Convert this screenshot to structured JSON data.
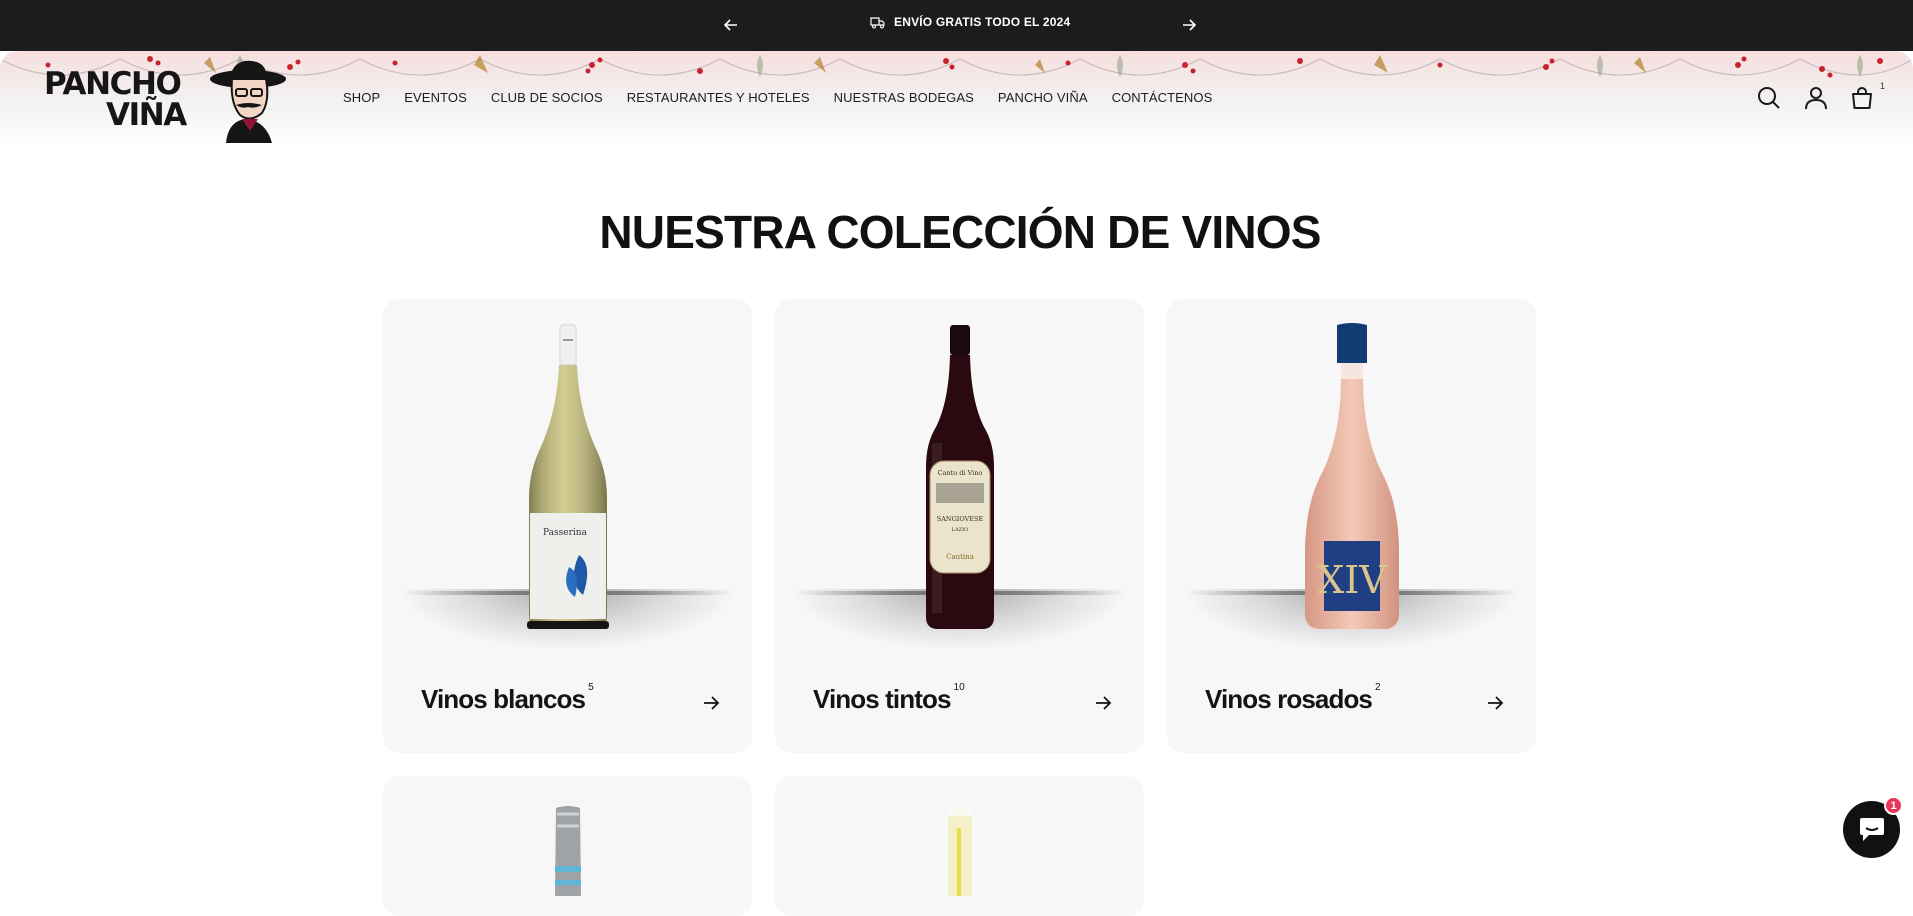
{
  "announcement": {
    "message": "ENVÍO GRATIS TODO EL 2024",
    "prev_icon": "arrow-left-icon",
    "next_icon": "arrow-right-icon"
  },
  "logo": {
    "line1": "PANCHO",
    "line2": "VIÑA"
  },
  "nav": [
    {
      "label": "SHOP"
    },
    {
      "label": "EVENTOS"
    },
    {
      "label": "CLUB DE SOCIOS"
    },
    {
      "label": "RESTAURANTES Y HOTELES"
    },
    {
      "label": "NUESTRAS BODEGAS"
    },
    {
      "label": "PANCHO VIÑA"
    },
    {
      "label": "CONTÁCTENOS"
    }
  ],
  "header_icons": {
    "search": "search-icon",
    "account": "user-icon",
    "cart": "bag-icon",
    "cart_count": "1"
  },
  "page": {
    "heading": "NUESTRA COLECCIÓN DE VINOS"
  },
  "collections": [
    {
      "title": "Vinos blancos",
      "count": "5"
    },
    {
      "title": "Vinos tintos",
      "count": "10"
    },
    {
      "title": "Vinos rosados",
      "count": "2"
    },
    {
      "title": "",
      "count": ""
    },
    {
      "title": "",
      "count": ""
    }
  ],
  "chat": {
    "badge": "1",
    "icon": "chat-bubble-icon"
  },
  "colors": {
    "announce_bg": "#1c1c1c",
    "card_bg": "#f7f7f7",
    "badge": "#e8375a"
  }
}
